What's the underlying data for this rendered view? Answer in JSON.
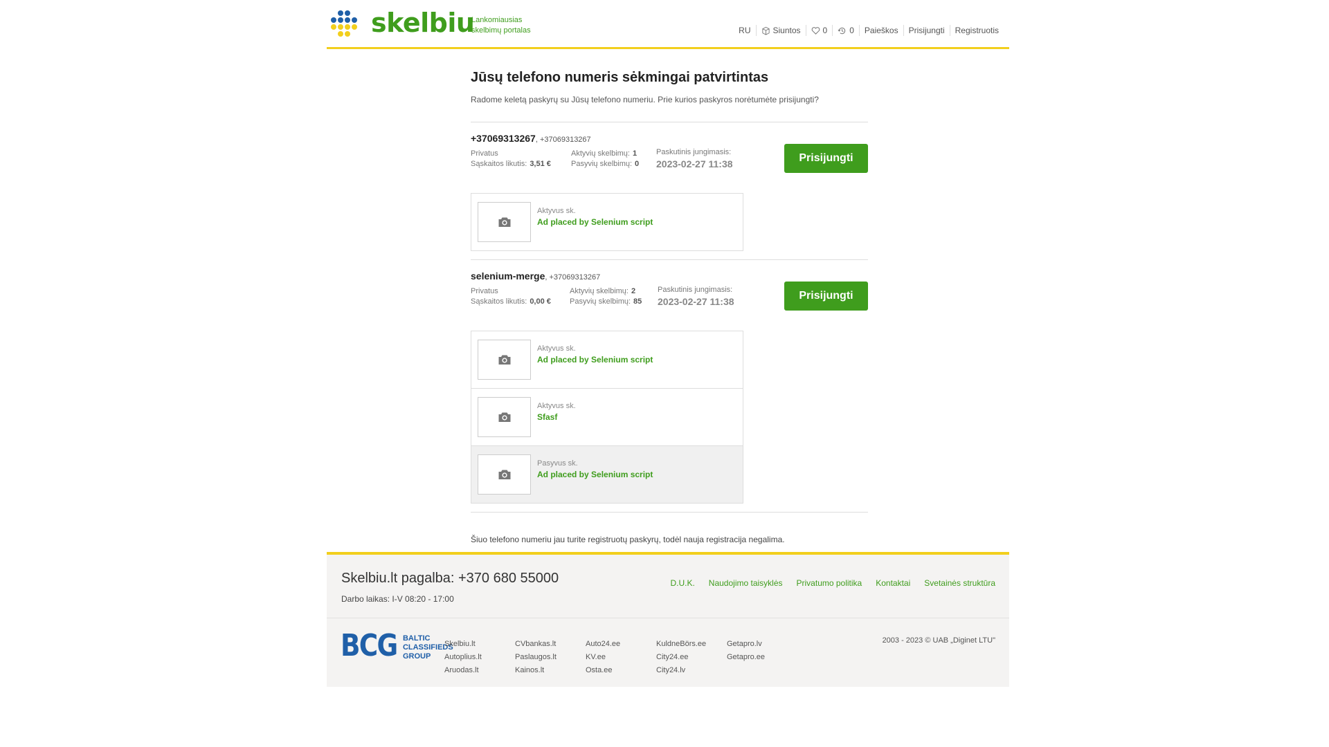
{
  "header": {
    "logo_text": "skelbiu",
    "tagline_line1": "Lankomiausias",
    "tagline_line2": "skelbimų portalas",
    "nav": {
      "ru": "RU",
      "siuntos": "Siuntos",
      "favorites_count": "0",
      "history_count": "0",
      "paieskos": "Paieškos",
      "prisijungti": "Prisijungti",
      "registruotis": "Registruotis"
    }
  },
  "main": {
    "title": "Jūsų telefono numeris sėkmingai patvirtintas",
    "subtitle": "Radome keletą paskyrų su Jūsų telefono numeriu. Prie kurios paskyros norėtumėte prisijungti?",
    "accounts": [
      {
        "name": "+37069313267",
        "phone": ", +37069313267",
        "type": "Privatus",
        "balance_label": "Sąskaitos likutis:",
        "balance": "3,51 €",
        "active_label": "Aktyvių skelbimų:",
        "active": "1",
        "passive_label": "Pasyvių skelbimų:",
        "passive": "0",
        "last_login_label": "Paskutinis jungimasis:",
        "last_login": "2023-02-27 11:38",
        "button": "Prisijungti",
        "ads": [
          {
            "status": "Aktyvus sk.",
            "title": "Ad placed by Selenium script"
          }
        ]
      },
      {
        "name": "selenium-merge",
        "phone": ", +37069313267",
        "type": "Privatus",
        "balance_label": "Sąskaitos likutis:",
        "balance": "0,00 €",
        "active_label": "Aktyvių skelbimų:",
        "active": "2",
        "passive_label": "Pasyvių skelbimų:",
        "passive": "85",
        "last_login_label": "Paskutinis jungimasis:",
        "last_login": "2023-02-27 11:38",
        "button": "Prisijungti",
        "ads": [
          {
            "status": "Aktyvus sk.",
            "title": "Ad placed by Selenium script"
          },
          {
            "status": "Aktyvus sk.",
            "title": "Sfasf"
          },
          {
            "status": "Pasyvus sk.",
            "title": "Ad placed by Selenium script"
          }
        ]
      }
    ],
    "note": "Šiuo telefono numeriu jau turite registruotų paskyrų, todėl nauja registracija negalima."
  },
  "footer": {
    "help": "Skelbiu.lt pagalba: +370 680 55000",
    "hours": "Darbo laikas: I-V 08:20 - 17:00",
    "links": [
      "D.U.K.",
      "Naudojimo taisyklės",
      "Privatumo politika",
      "Kontaktai",
      "Svetainės struktūra"
    ],
    "bcg_big": "BCG",
    "bcg_line1": "BALTIC",
    "bcg_line2": "CLASSIFIEDS",
    "bcg_line3": "GROUP",
    "partners": [
      [
        "Skelbiu.lt",
        "Autoplius.lt",
        "Aruodas.lt"
      ],
      [
        "CVbankas.lt",
        "Paslaugos.lt",
        "Kainos.lt"
      ],
      [
        "Auto24.ee",
        "KV.ee",
        "Osta.ee"
      ],
      [
        "KuldneBörs.ee",
        "City24.ee",
        "City24.lv"
      ],
      [
        "Getapro.lv",
        "Getapro.ee"
      ]
    ],
    "copyright": "2003 - 2023 © UAB „Diginet LTU\""
  },
  "colors": {
    "brand_green": "#3f9d1d",
    "accent_yellow": "#f2cf1d",
    "bcg_blue": "#1f5fa8"
  }
}
